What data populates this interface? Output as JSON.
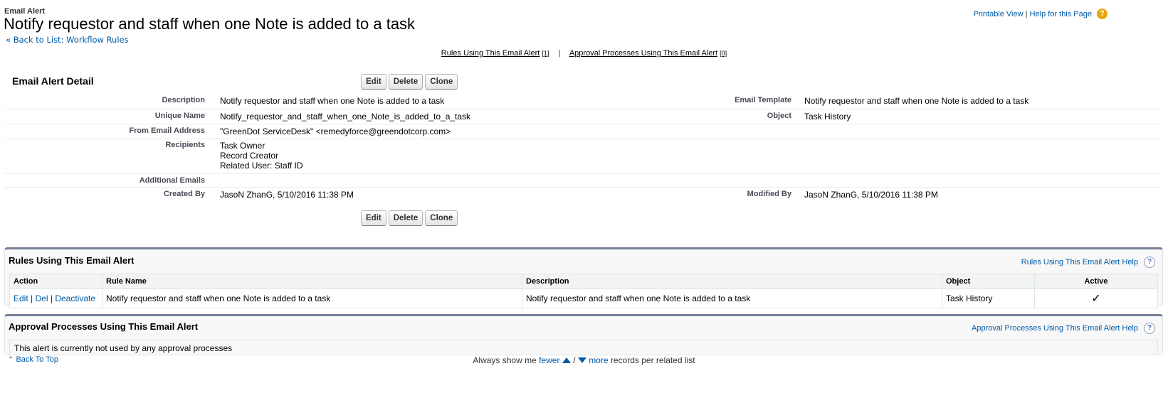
{
  "header": {
    "page_type": "Email Alert",
    "title": "Notify requestor and staff when one Note is added to a task",
    "back_link": "« Back to List: Workflow Rules",
    "printable_view": "Printable View",
    "help_link": "Help for this Page",
    "link_separator": "|",
    "help_icon_glyph": "?"
  },
  "related_links": {
    "rules": "Rules Using This Email Alert",
    "rules_count": "[1]",
    "approvals": "Approval Processes Using This Email Alert",
    "approvals_count": "[0]",
    "separator": "|"
  },
  "detail": {
    "heading": "Email Alert Detail",
    "buttons": {
      "edit": "Edit",
      "delete": "Delete",
      "clone": "Clone"
    },
    "description_label": "Description",
    "description": "Notify requestor and staff when one Note is added to a task",
    "email_template_label": "Email Template",
    "email_template": "Notify requestor and staff when one Note is added to a task",
    "unique_name_label": "Unique Name",
    "unique_name": "Notify_requestor_and_staff_when_one_Note_is_added_to_a_task",
    "object_label": "Object",
    "object": "Task History",
    "from_email_label": "From Email Address",
    "from_email": "\"GreenDot ServiceDesk\" <remedyforce@greendotcorp.com>",
    "recipients_label": "Recipients",
    "recipients": [
      "Task Owner",
      "Record Creator",
      "Related User: Staff ID"
    ],
    "additional_emails_label": "Additional Emails",
    "additional_emails": "",
    "created_by_label": "Created By",
    "created_by": "JasoN ZhanG, 5/10/2016 11:38 PM",
    "modified_by_label": "Modified By",
    "modified_by": "JasoN ZhanG, 5/10/2016 11:38 PM"
  },
  "rules_list": {
    "title": "Rules Using This Email Alert",
    "help": "Rules Using This Email Alert Help",
    "columns": [
      "Action",
      "Rule Name",
      "Description",
      "Object",
      "Active"
    ],
    "rows": [
      {
        "action_edit": "Edit",
        "action_del": "Del",
        "action_deactivate": "Deactivate",
        "action_sep": "|",
        "rule_name": "Notify requestor and staff when one Note is added to a task",
        "description": "Notify requestor and staff when one Note is added to a task",
        "object": "Task History",
        "active": "✓"
      }
    ]
  },
  "approvals_list": {
    "title": "Approval Processes Using This Email Alert",
    "help": "Approval Processes Using This Email Alert Help",
    "empty_message": "This alert is currently not used by any approval processes"
  },
  "footer": {
    "back_to_top": "Back To Top",
    "show_prefix": "Always show me",
    "fewer": "fewer",
    "slash": "/",
    "more": "more",
    "show_suffix": "records per related list"
  },
  "colors": {
    "link": "#015ba7",
    "help_icon": "#e5a70d",
    "related_list_top_border": "#747e96"
  }
}
